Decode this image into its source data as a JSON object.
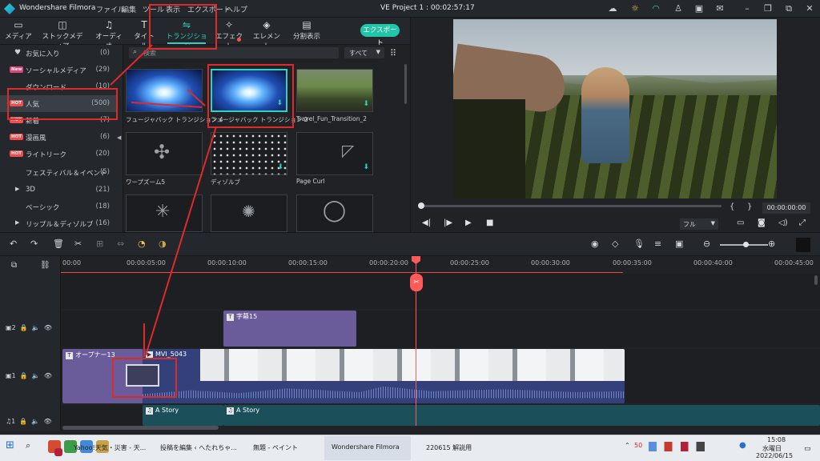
{
  "titlebar": {
    "app_name": "Wondershare Filmora",
    "menu": [
      "ファイル",
      "編集",
      "ツール",
      "表示",
      "エクスポート",
      "ヘルプ"
    ],
    "project": "VE Project 1 : 00:02:57:17"
  },
  "tabs": [
    {
      "label": "メディア",
      "icon": "folder-icon"
    },
    {
      "label": "ストックメディア",
      "icon": "stock-icon"
    },
    {
      "label": "オーディオ",
      "icon": "music-icon"
    },
    {
      "label": "タイトル",
      "icon": "text-icon"
    },
    {
      "label": "トランジション",
      "icon": "transition-icon",
      "active": true
    },
    {
      "label": "エフェクト",
      "icon": "effect-icon"
    },
    {
      "label": "エレメント",
      "icon": "element-icon"
    },
    {
      "label": "分割表示",
      "icon": "split-icon"
    }
  ],
  "export_label": "エクスポート",
  "sidebar": {
    "items": [
      {
        "label": "お気に入り",
        "count": "(0)",
        "badge": ""
      },
      {
        "label": "ソーシャルメディア",
        "count": "(29)",
        "badge": "New"
      },
      {
        "label": "ダウンロード",
        "count": "(10)",
        "badge": ""
      },
      {
        "label": "人気",
        "count": "(500)",
        "badge": "HOT"
      },
      {
        "label": "新着",
        "count": "(7)",
        "badge": "HOT"
      },
      {
        "label": "漫画風",
        "count": "(6)",
        "badge": "HOT"
      },
      {
        "label": "ライトリーク",
        "count": "(20)",
        "badge": "HOT"
      },
      {
        "label": "フェスティバル＆イベント",
        "count": "(5)",
        "badge": ""
      },
      {
        "label": "3D",
        "count": "(21)",
        "badge": ""
      },
      {
        "label": "ベーシック",
        "count": "(18)",
        "badge": ""
      },
      {
        "label": "リップル＆ディゾルブ",
        "count": "(16)",
        "badge": ""
      }
    ]
  },
  "library": {
    "search_placeholder": "検索",
    "filter": "すべて",
    "items": [
      {
        "label": "フュージャバック トランジション 4"
      },
      {
        "label": "フュージャバック トランジション 2"
      },
      {
        "label": "Travel_Fun_Transition_2"
      },
      {
        "label": "ワープズーム5"
      },
      {
        "label": "ディゾルブ"
      },
      {
        "label": "Page Curl"
      },
      {
        "label": ""
      },
      {
        "label": ""
      },
      {
        "label": ""
      }
    ]
  },
  "preview": {
    "timecode": "00:00:00:00",
    "quality": "フル",
    "brace_open": "{",
    "brace_close": "}"
  },
  "ruler": {
    "ticks": [
      "00:00",
      "00:00:05:00",
      "00:00:10:00",
      "00:00:15:00",
      "00:00:20:00",
      "00:00:25:00",
      "00:00:30:00",
      "00:00:35:00",
      "00:00:40:00",
      "00:00:45:00"
    ]
  },
  "tracks": {
    "track2": {
      "number": "2",
      "clip": "字幕15"
    },
    "track1": {
      "number": "1",
      "title_clip": "オープナー13",
      "video_clip": "MVI_5043"
    },
    "audio": {
      "number": "1",
      "clip_a": "A Story",
      "clip_b": "A Story"
    }
  },
  "taskbar": {
    "tasks": [
      "Yahoo!天気・災害 - 天...",
      "投稿を編集 ‹ へたれちゃ...",
      "無題 - ペイント",
      "Wondershare Filmora",
      "220615 解説用"
    ],
    "time": "15:08",
    "weekday": "水曜日",
    "date": "2022/06/15",
    "badge": "50"
  }
}
